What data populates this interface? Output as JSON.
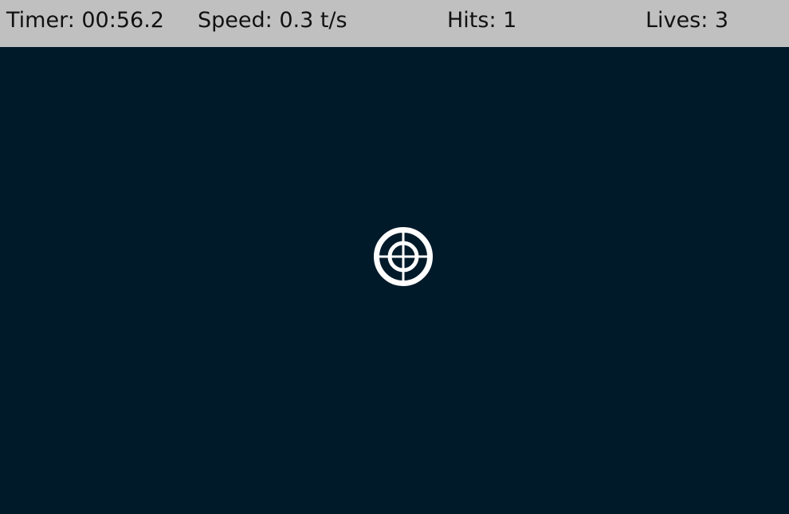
{
  "hud": {
    "timer_label": "Timer: 00:56.2",
    "speed_label": "Speed: 0.3 t/s",
    "hits_label": "Hits: 1",
    "lives_label": "Lives: 3"
  },
  "game": {
    "timer": "00:56.2",
    "speed": 0.3,
    "speed_unit": "t/s",
    "hits": 1,
    "lives": 3,
    "target_icon": "crosshair-target-icon"
  },
  "colors": {
    "hud_background": "#c0c0c0",
    "playfield_background": "#001a2a",
    "target": "#ffffff"
  }
}
